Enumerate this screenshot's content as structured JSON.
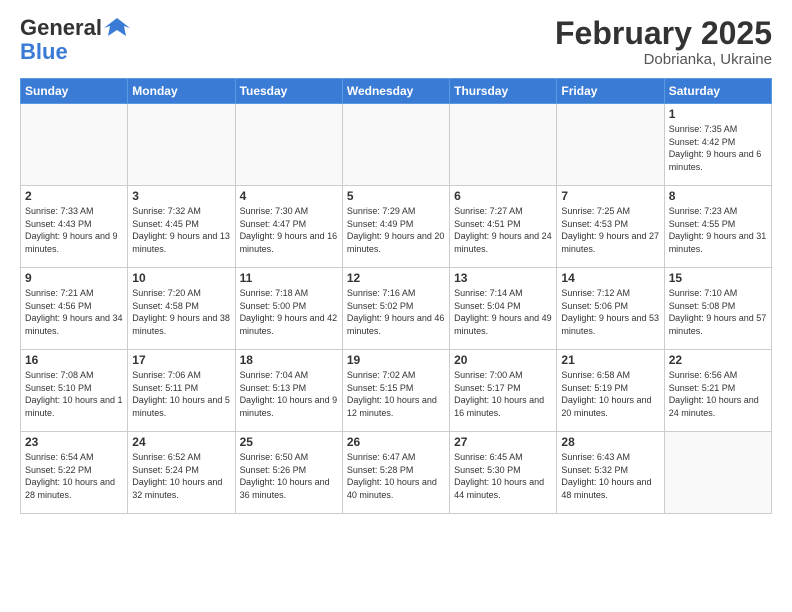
{
  "header": {
    "logo_general": "General",
    "logo_blue": "Blue",
    "month_year": "February 2025",
    "location": "Dobrianka, Ukraine"
  },
  "weekdays": [
    "Sunday",
    "Monday",
    "Tuesday",
    "Wednesday",
    "Thursday",
    "Friday",
    "Saturday"
  ],
  "weeks": [
    [
      {
        "day": "",
        "detail": ""
      },
      {
        "day": "",
        "detail": ""
      },
      {
        "day": "",
        "detail": ""
      },
      {
        "day": "",
        "detail": ""
      },
      {
        "day": "",
        "detail": ""
      },
      {
        "day": "",
        "detail": ""
      },
      {
        "day": "1",
        "detail": "Sunrise: 7:35 AM\nSunset: 4:42 PM\nDaylight: 9 hours and 6 minutes."
      }
    ],
    [
      {
        "day": "2",
        "detail": "Sunrise: 7:33 AM\nSunset: 4:43 PM\nDaylight: 9 hours and 9 minutes."
      },
      {
        "day": "3",
        "detail": "Sunrise: 7:32 AM\nSunset: 4:45 PM\nDaylight: 9 hours and 13 minutes."
      },
      {
        "day": "4",
        "detail": "Sunrise: 7:30 AM\nSunset: 4:47 PM\nDaylight: 9 hours and 16 minutes."
      },
      {
        "day": "5",
        "detail": "Sunrise: 7:29 AM\nSunset: 4:49 PM\nDaylight: 9 hours and 20 minutes."
      },
      {
        "day": "6",
        "detail": "Sunrise: 7:27 AM\nSunset: 4:51 PM\nDaylight: 9 hours and 24 minutes."
      },
      {
        "day": "7",
        "detail": "Sunrise: 7:25 AM\nSunset: 4:53 PM\nDaylight: 9 hours and 27 minutes."
      },
      {
        "day": "8",
        "detail": "Sunrise: 7:23 AM\nSunset: 4:55 PM\nDaylight: 9 hours and 31 minutes."
      }
    ],
    [
      {
        "day": "9",
        "detail": "Sunrise: 7:21 AM\nSunset: 4:56 PM\nDaylight: 9 hours and 34 minutes."
      },
      {
        "day": "10",
        "detail": "Sunrise: 7:20 AM\nSunset: 4:58 PM\nDaylight: 9 hours and 38 minutes."
      },
      {
        "day": "11",
        "detail": "Sunrise: 7:18 AM\nSunset: 5:00 PM\nDaylight: 9 hours and 42 minutes."
      },
      {
        "day": "12",
        "detail": "Sunrise: 7:16 AM\nSunset: 5:02 PM\nDaylight: 9 hours and 46 minutes."
      },
      {
        "day": "13",
        "detail": "Sunrise: 7:14 AM\nSunset: 5:04 PM\nDaylight: 9 hours and 49 minutes."
      },
      {
        "day": "14",
        "detail": "Sunrise: 7:12 AM\nSunset: 5:06 PM\nDaylight: 9 hours and 53 minutes."
      },
      {
        "day": "15",
        "detail": "Sunrise: 7:10 AM\nSunset: 5:08 PM\nDaylight: 9 hours and 57 minutes."
      }
    ],
    [
      {
        "day": "16",
        "detail": "Sunrise: 7:08 AM\nSunset: 5:10 PM\nDaylight: 10 hours and 1 minute."
      },
      {
        "day": "17",
        "detail": "Sunrise: 7:06 AM\nSunset: 5:11 PM\nDaylight: 10 hours and 5 minutes."
      },
      {
        "day": "18",
        "detail": "Sunrise: 7:04 AM\nSunset: 5:13 PM\nDaylight: 10 hours and 9 minutes."
      },
      {
        "day": "19",
        "detail": "Sunrise: 7:02 AM\nSunset: 5:15 PM\nDaylight: 10 hours and 12 minutes."
      },
      {
        "day": "20",
        "detail": "Sunrise: 7:00 AM\nSunset: 5:17 PM\nDaylight: 10 hours and 16 minutes."
      },
      {
        "day": "21",
        "detail": "Sunrise: 6:58 AM\nSunset: 5:19 PM\nDaylight: 10 hours and 20 minutes."
      },
      {
        "day": "22",
        "detail": "Sunrise: 6:56 AM\nSunset: 5:21 PM\nDaylight: 10 hours and 24 minutes."
      }
    ],
    [
      {
        "day": "23",
        "detail": "Sunrise: 6:54 AM\nSunset: 5:22 PM\nDaylight: 10 hours and 28 minutes."
      },
      {
        "day": "24",
        "detail": "Sunrise: 6:52 AM\nSunset: 5:24 PM\nDaylight: 10 hours and 32 minutes."
      },
      {
        "day": "25",
        "detail": "Sunrise: 6:50 AM\nSunset: 5:26 PM\nDaylight: 10 hours and 36 minutes."
      },
      {
        "day": "26",
        "detail": "Sunrise: 6:47 AM\nSunset: 5:28 PM\nDaylight: 10 hours and 40 minutes."
      },
      {
        "day": "27",
        "detail": "Sunrise: 6:45 AM\nSunset: 5:30 PM\nDaylight: 10 hours and 44 minutes."
      },
      {
        "day": "28",
        "detail": "Sunrise: 6:43 AM\nSunset: 5:32 PM\nDaylight: 10 hours and 48 minutes."
      },
      {
        "day": "",
        "detail": ""
      }
    ]
  ]
}
